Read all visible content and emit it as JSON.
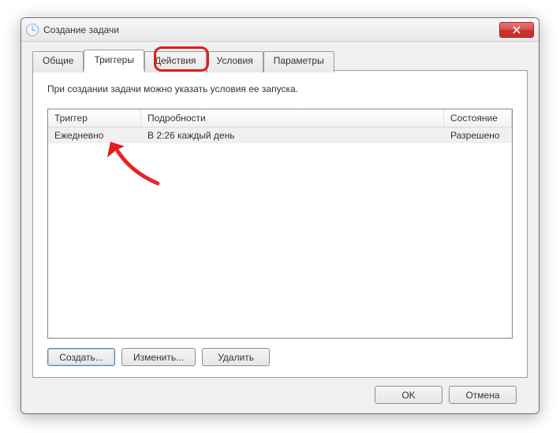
{
  "window": {
    "title": "Создание задачи"
  },
  "tabs": [
    {
      "label": "Общие"
    },
    {
      "label": "Триггеры"
    },
    {
      "label": "Действия"
    },
    {
      "label": "Условия"
    },
    {
      "label": "Параметры"
    }
  ],
  "instruction": "При создании задачи можно указать условия ее запуска.",
  "list": {
    "headers": {
      "trigger": "Триггер",
      "details": "Подробности",
      "state": "Состояние"
    },
    "rows": [
      {
        "trigger": "Ежедневно",
        "details": "В 2:26 каждый день",
        "state": "Разрешено"
      }
    ]
  },
  "buttons": {
    "create": "Создать...",
    "edit": "Изменить...",
    "delete": "Удалить",
    "ok": "OK",
    "cancel": "Отмена"
  }
}
